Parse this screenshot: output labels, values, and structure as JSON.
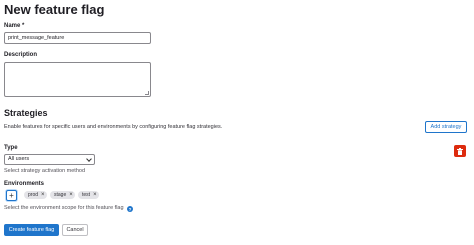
{
  "page": {
    "title": "New feature flag"
  },
  "name": {
    "label": "Name *",
    "value": "print_message_feature"
  },
  "description": {
    "label": "Description",
    "value": ""
  },
  "strategies": {
    "title": "Strategies",
    "description": "Enable features for specific users and environments by configuring feature flag strategies.",
    "add_button": "Add strategy",
    "type": {
      "label": "Type",
      "selected": "All users",
      "help": "Select strategy activation method"
    },
    "environments": {
      "label": "Environments",
      "add_icon": "plus-icon",
      "chips": [
        "prod",
        "stage",
        "test"
      ],
      "help": "Select the environment scope for this feature flag"
    },
    "delete_icon": "trash-icon"
  },
  "actions": {
    "create": "Create feature flag",
    "cancel": "Cancel"
  },
  "colors": {
    "primary": "#1f75cb",
    "danger": "#dd2b0e",
    "chip_bg": "#e4e4e8"
  }
}
